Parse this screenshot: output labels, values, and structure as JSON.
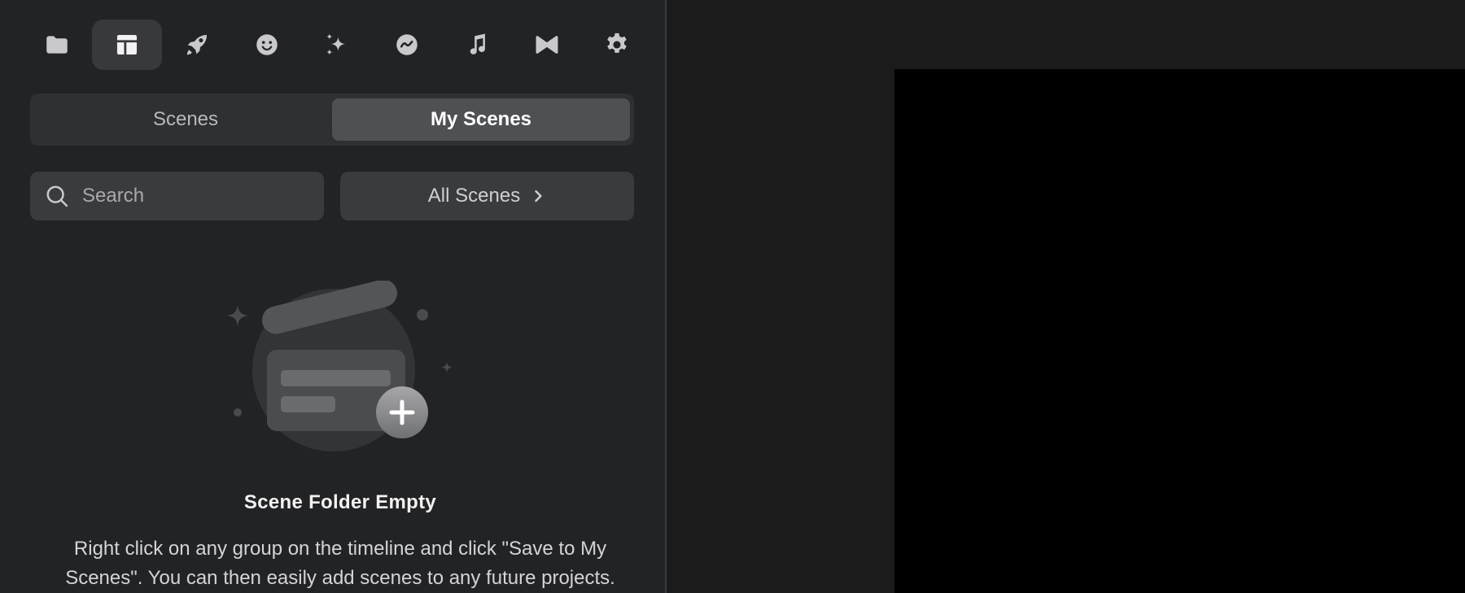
{
  "toolbar": {
    "icons": [
      "folder-icon",
      "layout-icon",
      "rocket-icon",
      "smiley-icon",
      "sparkles-icon",
      "chart-icon",
      "music-icon",
      "transition-icon",
      "gear-icon"
    ],
    "active": "layout-icon"
  },
  "tabs": [
    {
      "label": "Scenes",
      "active": false
    },
    {
      "label": "My Scenes",
      "active": true
    }
  ],
  "search": {
    "placeholder": "Search",
    "value": ""
  },
  "filter": {
    "label": "All Scenes"
  },
  "empty_state": {
    "title": "Scene Folder Empty",
    "description": "Right click on any group on the timeline and click \"Save to My Scenes\". You can then easily add scenes to any future projects."
  },
  "colors": {
    "sidebar_bg": "#222325",
    "active_tab_bg": "#4f5054",
    "canvas_bg": "#000000",
    "app_bg": "#1b1b1c"
  }
}
